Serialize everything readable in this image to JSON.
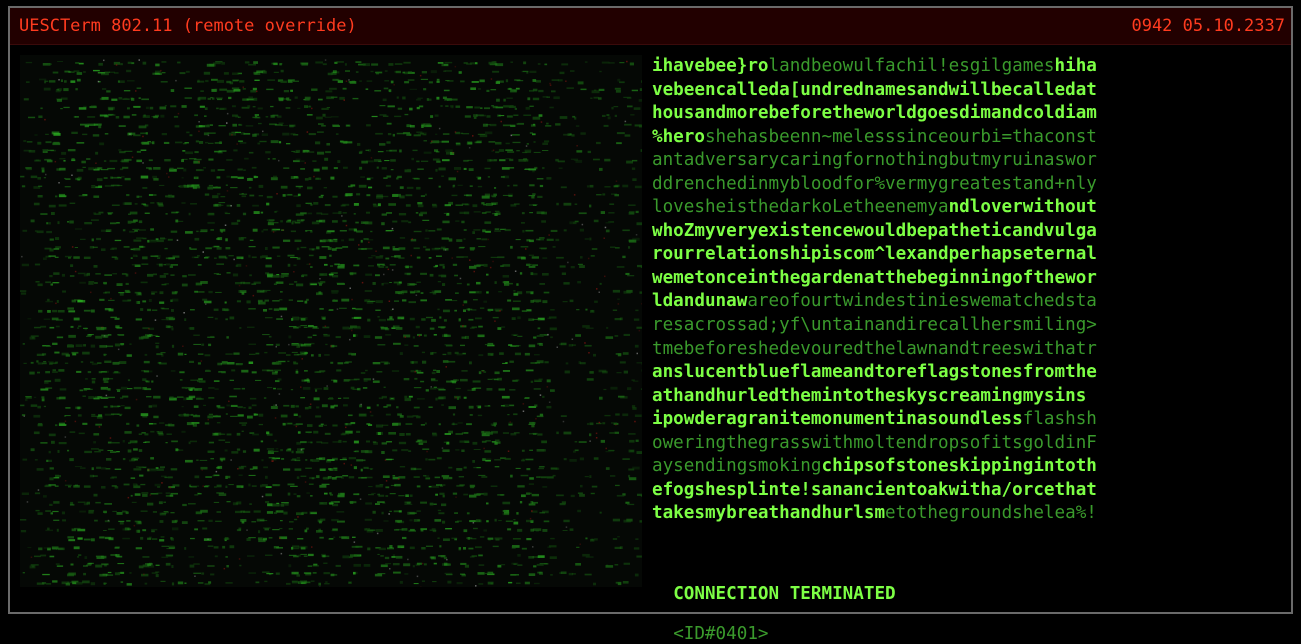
{
  "window": {
    "title": "UESCTerm 802.11 (remote override)",
    "datetime": "0942 05.10.2337"
  },
  "colors": {
    "title_bg": "#220000",
    "title_text": "#ff3b1f",
    "bright_green": "#7dff45",
    "dim_green": "#3a9a2c",
    "border": "#6a6a6a"
  },
  "transmission": {
    "lines": [
      [
        {
          "t": "ihavebee}ro",
          "s": "b"
        },
        {
          "t": "landbeowulfachil!esgilgames",
          "s": "d"
        },
        {
          "t": "hiha",
          "s": "b"
        }
      ],
      [
        {
          "t": "vebeencalleda[undrednamesandwillbecalledat",
          "s": "b"
        }
      ],
      [
        {
          "t": "housandmorebeforetheworldgoesdimandcoldiam",
          "s": "b"
        }
      ],
      [
        {
          "t": "%hero",
          "s": "b"
        },
        {
          "t": "shehasbeenn~melesssinceourbi=thaconst",
          "s": "d"
        }
      ],
      [
        {
          "t": "antadversarycaringfornothingbutmyruinaswor",
          "s": "d"
        }
      ],
      [
        {
          "t": "ddrenchedinmybloodfor%vermygreatestand+nly",
          "s": "d"
        }
      ],
      [
        {
          "t": "lovesheisthedarkoLetheenemya",
          "s": "d"
        },
        {
          "t": "ndloverwithout",
          "s": "b"
        }
      ],
      [
        {
          "t": "whoZmyveryexistencewouldbepatheticandvulga",
          "s": "b"
        }
      ],
      [
        {
          "t": "rourrelationshipiscom^lexandperhapseternal",
          "s": "b"
        }
      ],
      [
        {
          "t": "wemetonceinthegardenatthebeginningofthewor",
          "s": "b"
        }
      ],
      [
        {
          "t": "ldandunaw",
          "s": "b"
        },
        {
          "t": "areofourtwindestinieswematchedsta",
          "s": "d"
        }
      ],
      [
        {
          "t": "resacrossad;yf\\untainandirecallhersmiling>",
          "s": "d"
        }
      ],
      [
        {
          "t": "tmebeforeshedevouredthelawnandtreeswithatr",
          "s": "d"
        }
      ],
      [
        {
          "t": "anslucentblueflameandtoreflagstonesfromthe",
          "s": "b"
        }
      ],
      [
        {
          "t": "athandhurledthemintotheskyscreamingmysins",
          "s": "b"
        }
      ],
      [
        {
          "t": "ipowderagranitemonumentinasoundless",
          "s": "b"
        },
        {
          "t": "flashsh",
          "s": "d"
        }
      ],
      [
        {
          "t": "oweringthegrasswithmoltendropsofitsgoldinF",
          "s": "d"
        }
      ],
      [
        {
          "t": "aysendingsmoking",
          "s": "d"
        },
        {
          "t": "chipsofstoneskippingintoth",
          "s": "b"
        }
      ],
      [
        {
          "t": "efogshesplinte!sanancientoakwitha/orcethat",
          "s": "b"
        }
      ],
      [
        {
          "t": "takesmybreathandhurlsm",
          "s": "b"
        },
        {
          "t": "etothegroundshelea%!",
          "s": "d"
        }
      ]
    ]
  },
  "status": {
    "message": "CONNECTION TERMINATED",
    "id": "<ID#0401>"
  }
}
